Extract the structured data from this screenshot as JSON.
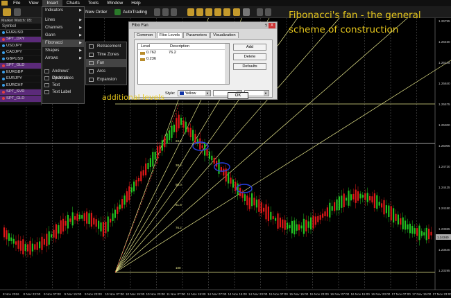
{
  "menubar": {
    "items": [
      "File",
      "View",
      "Insert",
      "Charts",
      "Tools",
      "Window",
      "Help"
    ]
  },
  "toolbar": {
    "new_order": "New Order",
    "autotrading": "AutoTrading"
  },
  "market_watch": {
    "title": "Market Watch: 05:",
    "header": "Symbol",
    "symbols": [
      "EURUSD",
      "SPT_DXY",
      "USDJPY",
      "CADJPY",
      "GBPUSD",
      "SPT_GLD",
      "EURGBP",
      "EURJPY",
      "EURCHF",
      "SPT_SVR",
      "SPT_GLD"
    ]
  },
  "insert_menu": {
    "items": [
      "Indicators",
      "Lines",
      "Channels",
      "Gann",
      "Fibonacci",
      "Shapes",
      "Arrows"
    ],
    "tools": [
      "Andrews' Pitchfork",
      "Cycle Lines",
      "Text",
      "Text Label"
    ]
  },
  "fibonacci_menu": {
    "items": [
      "Retracement",
      "Time Zones",
      "Fan",
      "Arcs",
      "Expansion"
    ]
  },
  "dialog": {
    "title": "Fibo Fan",
    "help": "?",
    "close": "X",
    "tabs": [
      "Common",
      "Fibo Levels",
      "Parameters",
      "Visualization"
    ],
    "table_headers": [
      "Level",
      "Description"
    ],
    "rows": [
      {
        "level": "0.762",
        "description": "76.2"
      },
      {
        "level": "0.236",
        "description": ""
      }
    ],
    "buttons": [
      "Add",
      "Delete",
      "Defaults"
    ],
    "style_label": "Style:",
    "color": "Yellow",
    "ok": "OK"
  },
  "annotations": {
    "title": "Fibonacci's fan - the general scheme of construction",
    "levels": "additional levels"
  },
  "chart_data": {
    "type": "candlestick",
    "price_axis": [
      "1.26755",
      "1.26460",
      "1.26145",
      "1.25840",
      "1.25575",
      "1.25300",
      "1.25005",
      "1.24720",
      "1.24425",
      "1.24180",
      "1.23865",
      "1.23640",
      "1.23295"
    ],
    "time_axis": [
      "8 Nov 2016",
      "8 Nov 23:00",
      "9 Nov 07:00",
      "9 Nov 15:00",
      "9 Nov 23:00",
      "10 Nov 07:00",
      "10 Nov 15:00",
      "10 Nov 23:00",
      "11 Nov 07:00",
      "11 Nov 15:00",
      "14 Nov 07:00",
      "14 Nov 15:00",
      "14 Nov 23:00",
      "15 Nov 07:00",
      "15 Nov 15:00",
      "15 Nov 23:00",
      "16 Nov 07:00",
      "16 Nov 15:00",
      "16 Nov 23:00",
      "17 Nov 07:00",
      "17 Nov 15:00",
      "17 Nov 23:00"
    ],
    "current_price": "1.24340",
    "fan_levels": [
      "23.6",
      "38.2",
      "50.0",
      "61.8",
      "76.2",
      "100"
    ],
    "colors": {
      "bull": "#22c322",
      "bear": "#e01818",
      "fan": "#e5e58a",
      "highlight": "#2840e0"
    }
  }
}
